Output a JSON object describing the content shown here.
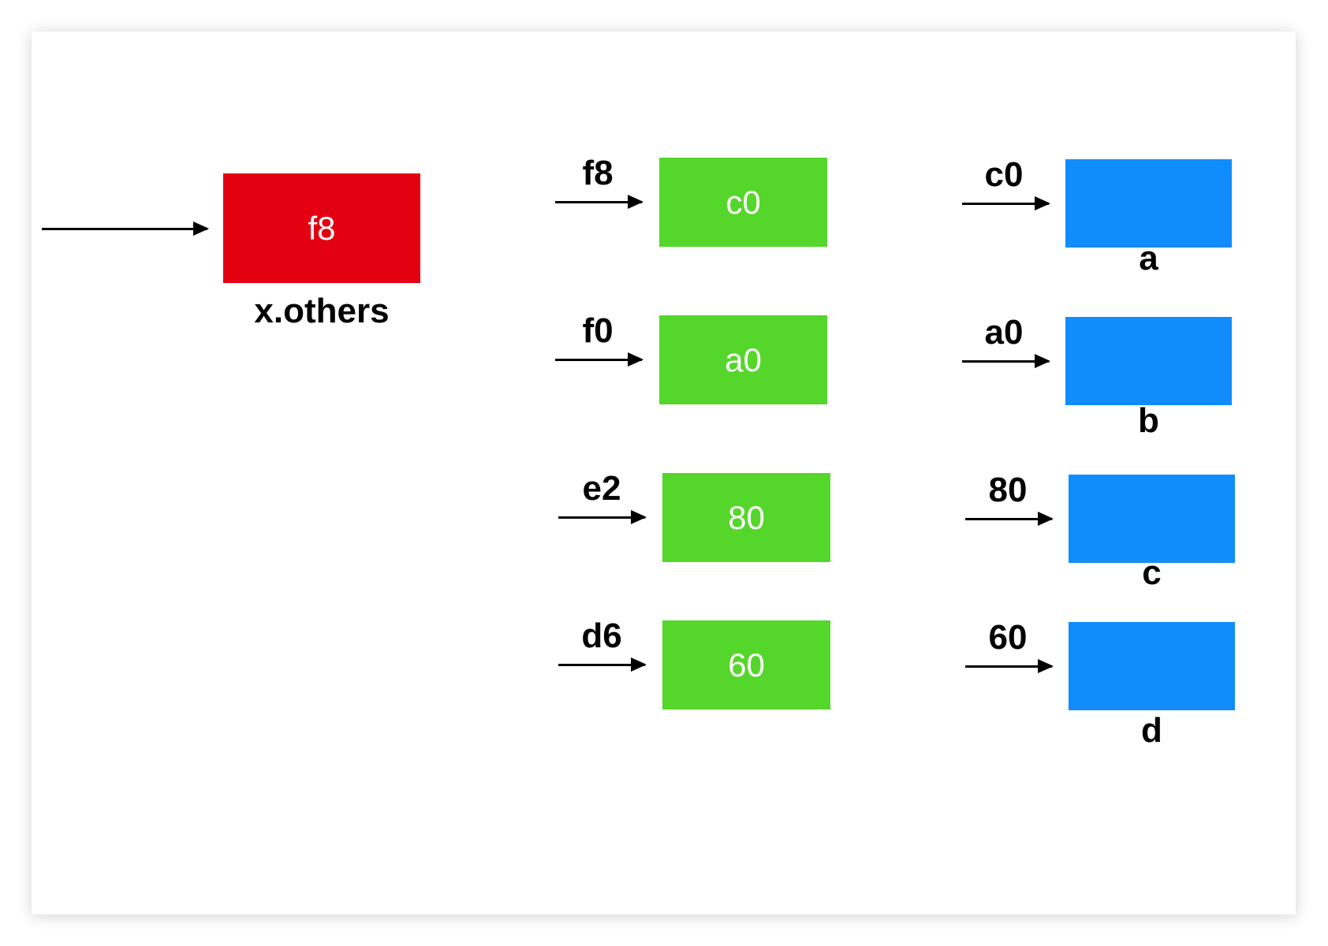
{
  "x_others": {
    "box_value": "f8",
    "caption": "x.others"
  },
  "column_middle": [
    {
      "address": "f8",
      "value": "c0"
    },
    {
      "address": "f0",
      "value": "a0"
    },
    {
      "address": "e2",
      "value": "80"
    },
    {
      "address": "d6",
      "value": "60"
    }
  ],
  "column_right": [
    {
      "address": "c0",
      "name": "a"
    },
    {
      "address": "a0",
      "name": "b"
    },
    {
      "address": "80",
      "name": "c"
    },
    {
      "address": "60",
      "name": "d"
    }
  ],
  "colors": {
    "pointer_box": "#e30011",
    "value_box": "#55d62b",
    "object_box": "#118cfc"
  }
}
